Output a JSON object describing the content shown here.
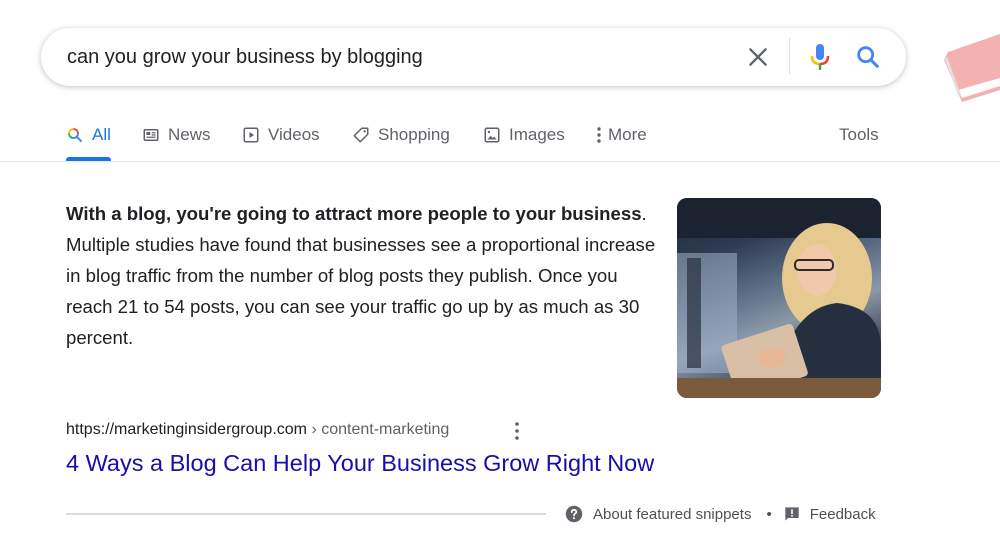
{
  "search": {
    "query": "can you grow your business by blogging",
    "clear_icon": "close-icon",
    "voice_icon": "microphone-icon",
    "search_icon": "search-icon"
  },
  "tabs": [
    {
      "label": "All",
      "icon": "search-icon",
      "active": true
    },
    {
      "label": "News",
      "icon": "newspaper-icon",
      "active": false
    },
    {
      "label": "Videos",
      "icon": "play-icon",
      "active": false
    },
    {
      "label": "Shopping",
      "icon": "tag-icon",
      "active": false
    },
    {
      "label": "Images",
      "icon": "image-icon",
      "active": false
    },
    {
      "label": "More",
      "icon": "more-vert-icon",
      "active": false
    }
  ],
  "tools_label": "Tools",
  "snippet": {
    "bold_text": "With a blog, you're going to attract more people to your business",
    "bold_suffix": ".",
    "body_text": "Multiple studies have found that businesses see a proportional increase in blog traffic from the number of blog posts they publish. Once you reach 21 to 54 posts, you can see your traffic go up by as much as 30 percent.",
    "image_alt": "Woman with glasses smiling while reading a tablet"
  },
  "result": {
    "url": "https://marketinginsidergroup.com",
    "breadcrumb": " › content-marketing",
    "title": "4 Ways a Blog Can Help Your Business Grow Right Now"
  },
  "footer": {
    "about_label": "About featured snippets",
    "separator": "•",
    "feedback_label": "Feedback"
  },
  "colors": {
    "accent": "#1a73e8",
    "link": "#1a0dab",
    "text": "#202124",
    "muted": "#5f6368"
  }
}
